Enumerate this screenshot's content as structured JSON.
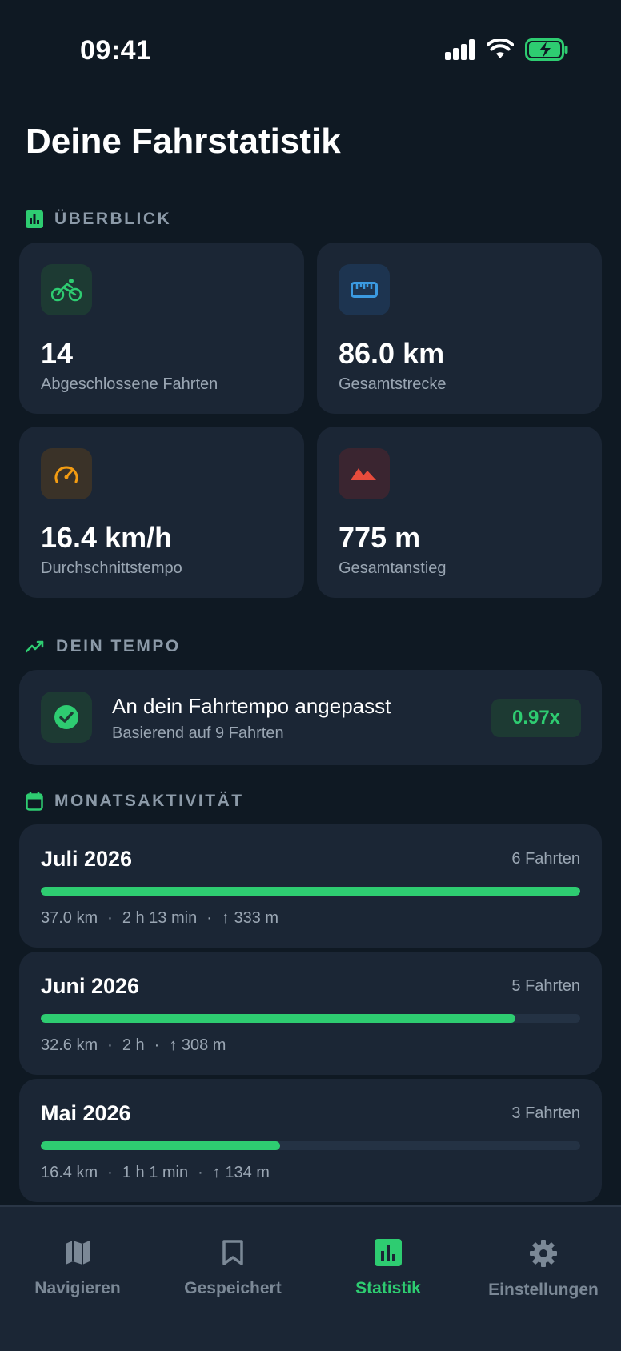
{
  "status_bar": {
    "time": "09:41"
  },
  "page": {
    "title": "Deine Fahrstatistik"
  },
  "sections": {
    "overview": "ÜBERBLICK",
    "tempo": "DEIN TEMPO",
    "monthly": "MONATSAKTIVITÄT"
  },
  "stats": [
    {
      "value": "14",
      "label": "Abgeschlossene Fahrten",
      "icon": "bicycle-icon",
      "color": "#2ecc71",
      "bg": "#1d3a33"
    },
    {
      "value": "86.0 km",
      "label": "Gesamtstrecke",
      "icon": "ruler-icon",
      "color": "#3b9ae1",
      "bg": "#1d3450"
    },
    {
      "value": "16.4 km/h",
      "label": "Durchschnittstempo",
      "icon": "speedometer-icon",
      "color": "#f39c12",
      "bg": "#3a3228"
    },
    {
      "value": "775 m",
      "label": "Gesamtanstieg",
      "icon": "mountain-icon",
      "color": "#e74c3c",
      "bg": "#3a2530"
    }
  ],
  "tempo": {
    "title": "An dein Fahrtempo angepasst",
    "subtitle": "Basierend auf 9 Fahrten",
    "factor": "0.97x"
  },
  "months": [
    {
      "name": "Juli 2026",
      "count": "6 Fahrten",
      "progress": 1.0,
      "distance": "37.0 km",
      "duration": "2 h 13 min",
      "elevation": "↑ 333 m"
    },
    {
      "name": "Juni 2026",
      "count": "5 Fahrten",
      "progress": 0.88,
      "distance": "32.6 km",
      "duration": "2 h",
      "elevation": "↑ 308 m"
    },
    {
      "name": "Mai 2026",
      "count": "3 Fahrten",
      "progress": 0.443,
      "distance": "16.4 km",
      "duration": "1 h 1 min",
      "elevation": "↑ 134 m"
    }
  ],
  "separator": "·",
  "tabs": [
    {
      "label": "Navigieren",
      "icon": "map-icon",
      "active": false
    },
    {
      "label": "Gespeichert",
      "icon": "bookmark-icon",
      "active": false
    },
    {
      "label": "Statistik",
      "icon": "bar-chart-icon",
      "active": true
    },
    {
      "label": "Einstellungen",
      "icon": "gear-icon",
      "active": false
    }
  ],
  "colors": {
    "accent": "#2ecc71",
    "background": "#0f1923",
    "card": "#1b2635"
  }
}
